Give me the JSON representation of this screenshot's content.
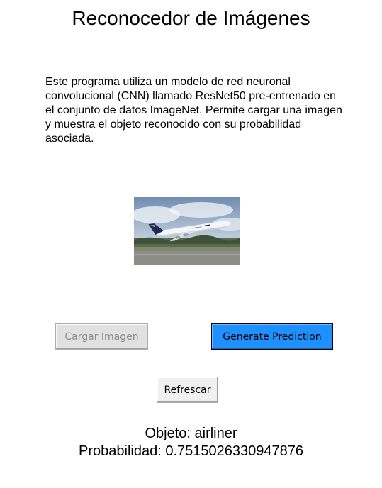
{
  "app": {
    "title": "Reconocedor de Imágenes"
  },
  "description": {
    "text": "Este programa utiliza un modelo de red neuronal convolucional (CNN) llamado ResNet50 pre-entrenado en el conjunto de datos ImageNet. Permite cargar una imagen y muestra el objeto reconocido con su probabilidad asociada."
  },
  "preview": {
    "icon": "airliner-photo"
  },
  "buttons": {
    "load_label": "Cargar Imagen",
    "load_enabled": false,
    "predict_label": "Generate Prediction",
    "refresh_label": "Refrescar"
  },
  "result": {
    "object_text": "Objeto: airliner",
    "probability_text": "Probabilidad: 0.7515026330947876"
  },
  "colors": {
    "predict_button": "#1e90ff",
    "load_button_disabled": "#e1e1e1",
    "background": "#ffffff"
  }
}
